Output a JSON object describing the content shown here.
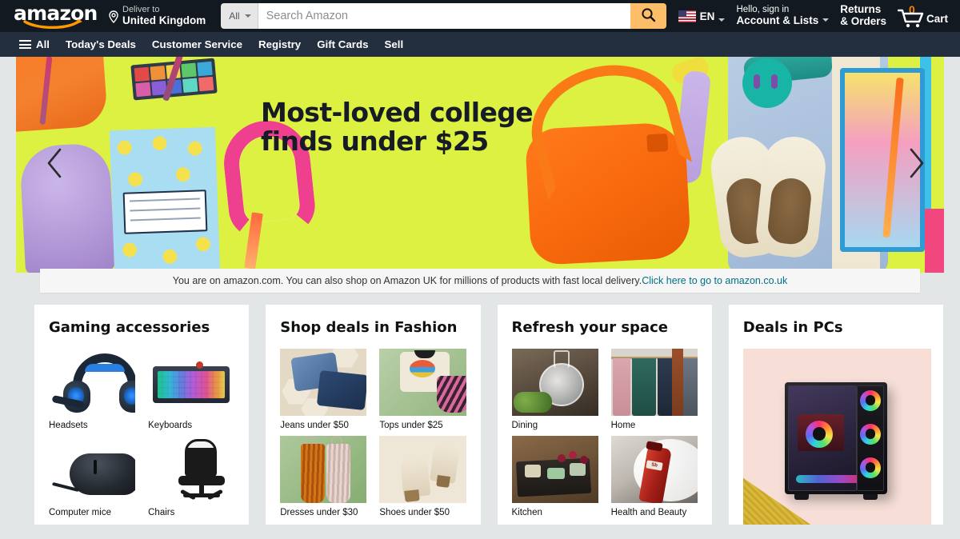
{
  "header": {
    "logo_text": "amazon",
    "deliver": {
      "line1": "Deliver to",
      "line2": "United Kingdom",
      "icon": "location-pin-icon"
    },
    "search": {
      "category": "All",
      "placeholder": "Search Amazon",
      "value": "",
      "button_icon": "search-icon",
      "button_color": "#febd69"
    },
    "language": {
      "label": "EN",
      "flag": "us-flag-icon"
    },
    "account": {
      "line1": "Hello, sign in",
      "line2": "Account & Lists"
    },
    "returns": {
      "line1": "Returns",
      "line2": "& Orders"
    },
    "cart": {
      "count": "0",
      "label": "Cart",
      "icon": "shopping-cart-icon",
      "count_color": "#f08804"
    },
    "bg_color": "#131921"
  },
  "nav": {
    "bg_color": "#232f3e",
    "items": [
      {
        "label": "All",
        "icon": "hamburger-menu-icon"
      },
      {
        "label": "Today's Deals"
      },
      {
        "label": "Customer Service"
      },
      {
        "label": "Registry"
      },
      {
        "label": "Gift Cards"
      },
      {
        "label": "Sell"
      }
    ]
  },
  "hero": {
    "headline_line1": "Most-loved college",
    "headline_line2": "finds under $25",
    "bg_color": "#dcf141",
    "text_color": "#161b25",
    "prev_icon": "chevron-left-icon",
    "next_icon": "chevron-right-icon"
  },
  "notice": {
    "text_before": "You are on amazon.com. You can also shop on Amazon UK for millions of products with fast local delivery. ",
    "link_text": "Click here to go to amazon.co.uk",
    "link_color": "#007185"
  },
  "cards": [
    {
      "title": "Gaming accessories",
      "type": "quad",
      "tiles": [
        {
          "caption": "Headsets",
          "art": "gaming-headset"
        },
        {
          "caption": "Keyboards",
          "art": "gaming-keyboard"
        },
        {
          "caption": "Computer mice",
          "art": "gaming-mouse"
        },
        {
          "caption": "Chairs",
          "art": "gaming-chair"
        }
      ]
    },
    {
      "title": "Shop deals in Fashion",
      "type": "quad",
      "tiles": [
        {
          "caption": "Jeans under $50",
          "art": "folded-jeans"
        },
        {
          "caption": "Tops under $25",
          "art": "tops"
        },
        {
          "caption": "Dresses under $30",
          "art": "dresses"
        },
        {
          "caption": "Shoes under $50",
          "art": "ankle-boots"
        }
      ]
    },
    {
      "title": "Refresh your space",
      "type": "quad",
      "tiles": [
        {
          "caption": "Dining",
          "art": "dining-glassware"
        },
        {
          "caption": "Home",
          "art": "towels-on-rail"
        },
        {
          "caption": "Kitchen",
          "art": "charcuterie-board"
        },
        {
          "caption": "Health and Beauty",
          "art": "body-wash-bottle"
        }
      ]
    },
    {
      "title": "Deals in PCs",
      "type": "single",
      "tiles": [
        {
          "caption": "",
          "art": "rgb-gaming-pc-tower"
        }
      ]
    }
  ]
}
